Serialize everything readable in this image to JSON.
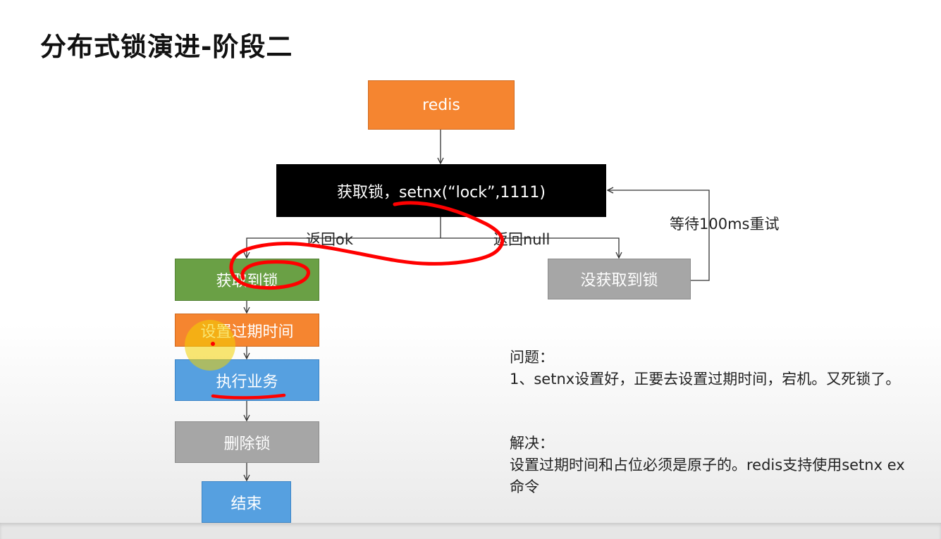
{
  "title": "分布式锁演进-阶段二",
  "nodes": {
    "redis": "redis",
    "acquire": "获取锁，setnx(“lock”,1111)",
    "got_lock": "获取到锁",
    "set_expire": "设置过期时间",
    "execute": "执行业务",
    "delete_lock": "删除锁",
    "end": "结束",
    "no_lock": "没获取到锁"
  },
  "edges": {
    "return_ok": "返回ok",
    "return_null": "返回null",
    "retry": "等待100ms重试"
  },
  "notes": {
    "problem_heading": "问题：",
    "problem_text": "1、setnx设置好，正要去设置过期时间，宕机。又死锁了。",
    "solution_heading": "解决：",
    "solution_text": "设置过期时间和占位必须是原子的。redis支持使用setnx ex命令"
  },
  "colors": {
    "orange": "#f58530",
    "black": "#000000",
    "green": "#6aa045",
    "gray": "#a6a6a6",
    "blue": "#56a0e0",
    "annotation_red": "#ff0000",
    "cursor_yellow": "#f2d200"
  }
}
